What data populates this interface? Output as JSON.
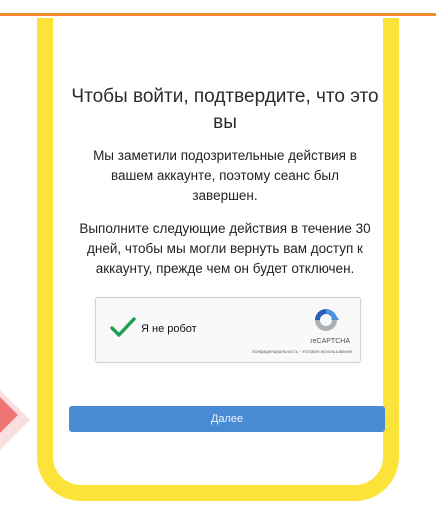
{
  "colors": {
    "accent_orange": "#f28a2e",
    "frame_yellow": "#fbe33a",
    "button_blue": "#4a8bd6",
    "check_green": "#1e9e4f"
  },
  "page": {
    "title": "Чтобы войти, подтвердите, что это вы",
    "notice": "Мы заметили подозрительные действия в вашем аккаунте, поэтому сеанс был завершен.",
    "instructions": "Выполните следующие действия в течение 30 дней, чтобы мы могли вернуть вам доступ к аккаунту, прежде чем он будет отключен."
  },
  "captcha": {
    "label": "Я не робот",
    "brand": "reCAPTCHA",
    "privacy_link": "Конфиденциальность",
    "separator": "-",
    "terms_link": "Условия использования",
    "check_icon": "checkmark-icon",
    "logo_icon": "recaptcha-logo-icon"
  },
  "actions": {
    "next_label": "Далее"
  }
}
